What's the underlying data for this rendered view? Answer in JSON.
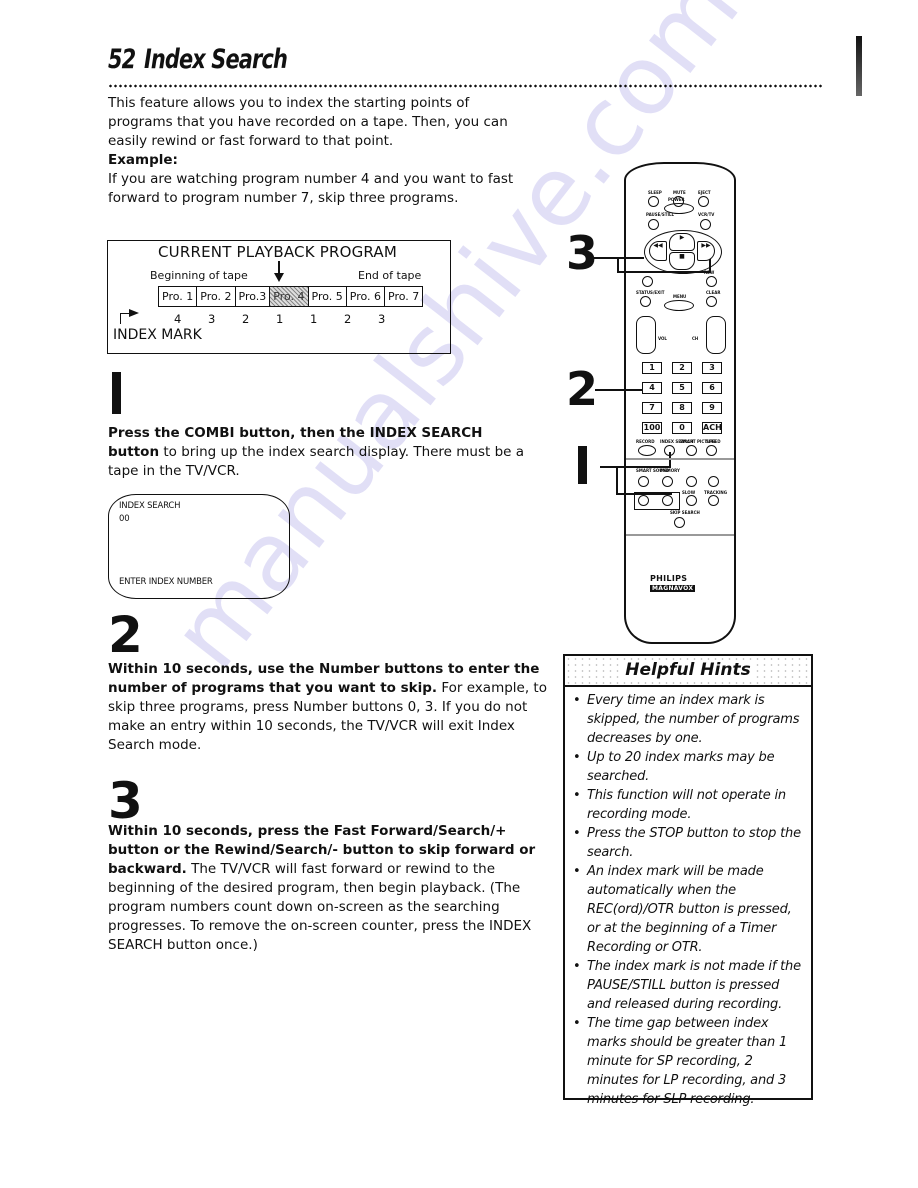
{
  "page": {
    "number": "52",
    "title": "Index Search"
  },
  "intro": {
    "text": "This feature allows you to index the starting points of programs that you have recorded on a tape. Then, you can easily rewind or fast forward to that point.",
    "example_label": "Example:",
    "example_text": "If you are watching program number 4 and you want to fast forward to program number 7, skip three programs."
  },
  "diagram": {
    "title": "CURRENT PLAYBACK PROGRAM",
    "beginning_label": "Beginning of tape",
    "end_label": "End of tape",
    "programs": [
      "Pro. 1",
      "Pro. 2",
      "Pro.3",
      "Pro. 4",
      "Pro. 5",
      "Pro. 6",
      "Pro. 7"
    ],
    "current_program_index": 3,
    "counts": [
      "4",
      "3",
      "2",
      "1",
      "1",
      "2",
      "3"
    ],
    "index_mark_label": "INDEX MARK"
  },
  "steps": [
    {
      "number": "1",
      "bold": "Press the COMBI button, then the INDEX SEARCH button",
      "text": " to bring up the index search display. There must be a tape in the TV/VCR."
    },
    {
      "number": "2",
      "bold": "Within 10 seconds, use the Number buttons to enter the number of programs that you want to skip.",
      "text": " For example, to skip three programs, press Number buttons 0, 3. If you do not make an entry within 10 seconds, the TV/VCR will exit Index Search mode."
    },
    {
      "number": "3",
      "bold": "Within 10 seconds, press the Fast Forward/Search/+ button or the Rewind/Search/- button to skip forward or backward.",
      "text": " The TV/VCR will fast forward or rewind to the beginning of the desired program, then begin playback. (The program numbers count down on-screen as the searching progresses. To remove the on-screen counter, press the INDEX SEARCH button once.)"
    }
  ],
  "osd": {
    "title": "INDEX SEARCH",
    "value": "00",
    "prompt": "ENTER INDEX NUMBER"
  },
  "hints": {
    "title": "Helpful Hints",
    "items": [
      "Every time an index mark is skipped, the number of programs decreases by one.",
      "Up to 20 index marks may be searched.",
      "This function will not operate in recording mode.",
      "Press the STOP button to stop the search.",
      "An index mark will be made automatically when the REC(ord)/OTR button is pressed, or at the beginning of a Timer Recording or OTR.",
      "The index mark is not made if the PAUSE/STILL button is pressed and released during recording.",
      "The time gap between index marks should be greater than 1 minute for SP recording, 2 minutes for LP recording, and 3 minutes for SLP recording."
    ]
  },
  "remote": {
    "labels": {
      "sleep": "SLEEP",
      "mute": "MUTE",
      "eject": "EJECT",
      "pause": "PAUSE/STILL",
      "power": "POWER",
      "vcrtv": "VCR/TV",
      "status": "STATUS/EXIT",
      "clear": "CLEAR",
      "menu": "MENU",
      "rew": "REW",
      "vol": "VOL",
      "ch": "CH",
      "record": "RECORD",
      "index": "INDEX SEARCH",
      "smartpic": "SMART PICTURE",
      "speed": "SPEED",
      "smartsound": "SMART SOUND",
      "memory": "MEMORY",
      "slow": "SLOW",
      "tracking": "TRACKING",
      "skip": "SKIP SEARCH"
    },
    "keys": [
      "1",
      "2",
      "3",
      "4",
      "5",
      "6",
      "7",
      "8",
      "9",
      "100",
      "0",
      "ACH"
    ],
    "brand": "PHILIPS",
    "brand_sub": "MAGNAVOX",
    "callouts": [
      "3",
      "2",
      "1"
    ]
  },
  "watermark": "manualshive.com"
}
